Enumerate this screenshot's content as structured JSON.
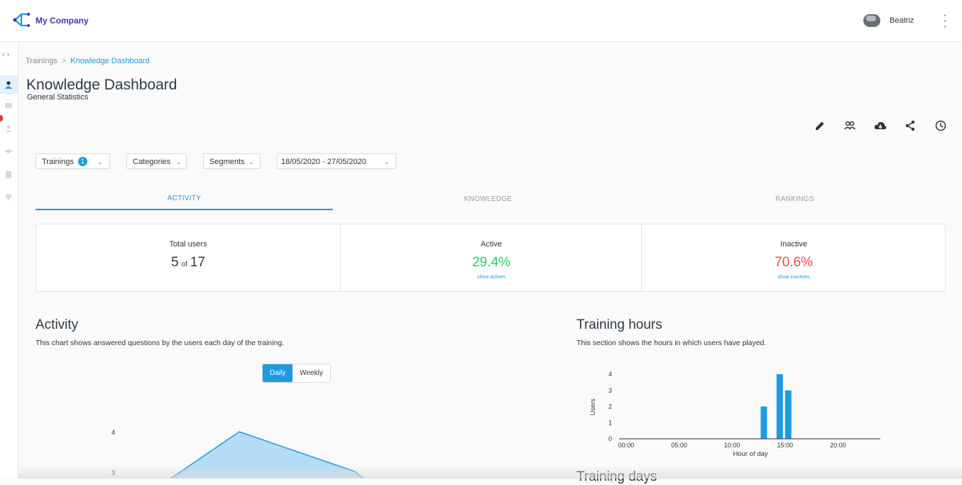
{
  "app": {
    "brand": "My Company",
    "user": "Beatriz"
  },
  "breadcrumb": {
    "parent": "Trainings",
    "separator": ">",
    "current": "Knowledge Dashboard"
  },
  "page": {
    "title": "Knowledge Dashboard",
    "subtitle": "General Statistics"
  },
  "actions": [
    "edit-icon",
    "users-icon",
    "cloud-download-icon",
    "share-icon",
    "clock-icon"
  ],
  "filters": {
    "trainings_label": "Trainings",
    "trainings_count": "1",
    "categories_label": "Categories",
    "segments_label": "Segments",
    "date_range": "18/05/2020 - 27/05/2020"
  },
  "tabs": [
    {
      "label": "ACTIVITY",
      "active": true
    },
    {
      "label": "KNOWLEDGE",
      "active": false
    },
    {
      "label": "RANKINGS",
      "active": false
    }
  ],
  "stats": {
    "total": {
      "label": "Total users",
      "value": "5",
      "of": "of",
      "total": "17"
    },
    "active": {
      "label": "Active",
      "value": "29.4%",
      "link": "show actives"
    },
    "inactive": {
      "label": "Inactive",
      "value": "70.6%",
      "link": "show inactives"
    }
  },
  "activity": {
    "title": "Activity",
    "description": "This chart shows answered questions by the users each day of the training.",
    "toggle": {
      "daily": "Daily",
      "weekly": "Weekly"
    }
  },
  "training_hours": {
    "title": "Training hours",
    "description": "This section shows the hours in which users have played."
  },
  "training_days": {
    "title": "Training days"
  },
  "colors": {
    "accent": "#1e9be0",
    "green": "#2ecc71",
    "red": "#ef4e4e",
    "brand": "#3b3aa8"
  },
  "chart_data": [
    {
      "type": "area",
      "yticks_visible": [
        "4",
        "3"
      ],
      "y": [
        4,
        3.6
      ]
    },
    {
      "type": "bar",
      "xlabel": "Hour of day",
      "ylabel": "Users",
      "ylim": [
        0,
        4
      ],
      "yticks": [
        "0",
        "1",
        "2",
        "3",
        "4"
      ],
      "xticks": [
        "00:00",
        "05:00",
        "10:00",
        "15:00",
        "20:00"
      ],
      "bars": [
        {
          "hour": 13,
          "value": 2
        },
        {
          "hour": 14.5,
          "value": 4
        },
        {
          "hour": 15.3,
          "value": 3
        }
      ]
    }
  ]
}
